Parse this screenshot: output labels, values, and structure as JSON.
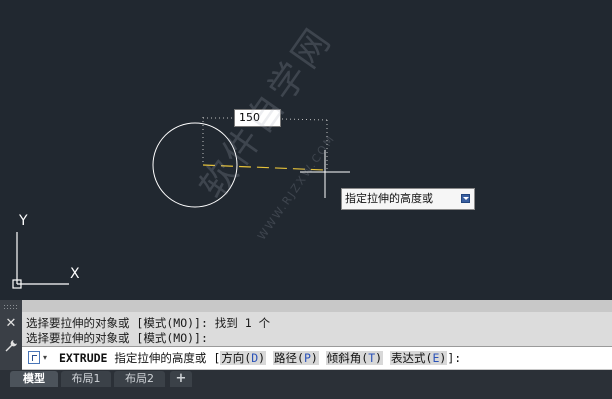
{
  "viewport": {
    "dynamic_input_value": "150",
    "tooltip_text": "指定拉伸的高度或",
    "ucs_axis_x_label": "X",
    "ucs_axis_y_label": "Y",
    "watermark_text": "软件自学网",
    "watermark_url": "WWW.RJZXW.COM"
  },
  "command_history": {
    "lines": [
      "选择要拉伸的对象或 [模式(MO)]: 找到 1 个",
      "选择要拉伸的对象或 [模式(MO)]:"
    ]
  },
  "command_prompt": {
    "command_name": "EXTRUDE",
    "prompt_text": "指定拉伸的高度或 [",
    "options": [
      {
        "label": "方向",
        "key": "D"
      },
      {
        "label": "路径",
        "key": "P"
      },
      {
        "label": "倾斜角",
        "key": "T"
      },
      {
        "label": "表达式",
        "key": "E"
      }
    ],
    "suffix": "]:"
  },
  "layout_tabs": {
    "tabs": [
      "模型",
      "布局1",
      "布局2"
    ],
    "active": "模型",
    "add_label": "+"
  },
  "colors": {
    "viewport_bg": "#212830",
    "dimension_line": "#e6c23a",
    "geometry": "#ffffff",
    "option_key": "#2a52b8"
  }
}
